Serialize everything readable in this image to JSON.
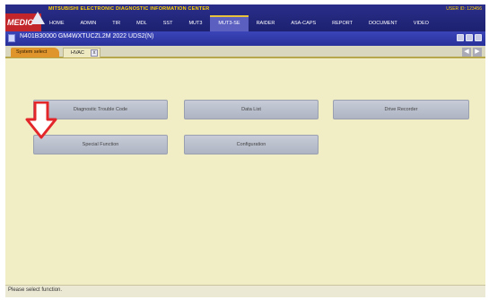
{
  "banner": {
    "logo_text": "MEDIC",
    "title": "MITSUBISHI  ELECTRONIC  DIAGNOSTIC  INFORMATION  CENTER",
    "user_id": "USER ID:  123456"
  },
  "nav": {
    "items": [
      "HOME",
      "ADMIN",
      "TIR",
      "MDL",
      "SST",
      "MUT3",
      "MUT3-SE",
      "RAIDER",
      "ASA-CAPS",
      "REPORT",
      "DOCUMENT",
      "VIDEO"
    ],
    "active": "MUT3-SE"
  },
  "window": {
    "title": "N401B30000  GM4WXTUCZL2M 2022  UDS2(N)"
  },
  "tabs": {
    "system_select": "System select",
    "hvac": "HVAC",
    "close_glyph": "x"
  },
  "functions": {
    "dtc": "Diagnostic Trouble Code",
    "data_list": "Data List",
    "drive_recorder": "Drive Recorder",
    "special_function": "Special Function",
    "configuration": "Configuration"
  },
  "status": {
    "text": "Please select function."
  },
  "colors": {
    "annotation_arrow": "#e3262a",
    "content_background": "#f1eec6",
    "system_select_tab": "#e0942c"
  }
}
